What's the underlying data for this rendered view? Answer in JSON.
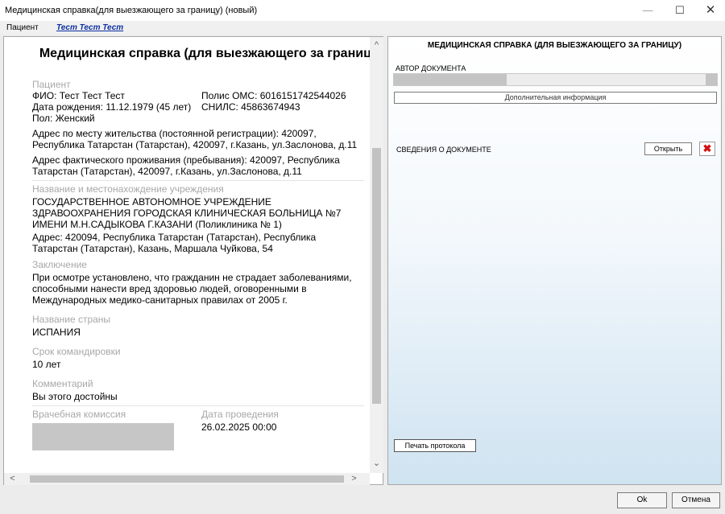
{
  "window": {
    "title": "Медицинская справка(для выезжающего за границу) (новый)",
    "minimize": "—",
    "maximize": "☐",
    "close": "✕"
  },
  "menubar": {
    "patient_label": "Пациент",
    "patient_name": "Тест Тест Тест"
  },
  "document": {
    "title": "Медицинская справка (для выезжающего за границу)",
    "patient_section": "Пациент",
    "fio": "ФИО: Тест Тест Тест",
    "oms": "Полис ОМС: 6016151742544026",
    "dob": "Дата рождения: 11.12.1979 (45 лет)",
    "snils": "СНИЛС: 45863674943",
    "sex": "Пол: Женский",
    "reg_address": "Адрес по месту жительства (постоянной регистрации): 420097, Республика Татарстан (Татарстан), 420097, г.Казань, ул.Заслонова, д.11",
    "fact_address": "Адрес фактического проживания (пребывания): 420097, Республика Татарстан (Татарстан), 420097, г.Казань, ул.Заслонова, д.11",
    "org_section": "Название и местонахождение учреждения",
    "org_name": "ГОСУДАРСТВЕННОЕ АВТОНОМНОЕ УЧРЕЖДЕНИЕ ЗДРАВООХРАНЕНИЯ ГОРОДСКАЯ КЛИНИЧЕСКАЯ БОЛЬНИЦА №7 ИМЕНИ М.Н.САДЫКОВА Г.КАЗАНИ (Поликлиника № 1)",
    "org_address": "Адрес: 420094, Республика Татарстан (Татарстан), Республика Татарстан (Татарстан), Казань, Маршала Чуйкова, 54",
    "conclusion_section": "Заключение",
    "conclusion": "При осмотре установлено, что гражданин не страдает заболеваниями, способными нанести вред здоровью людей, оговоренными в Международных медико-санитарных правилах от 2005 г.",
    "country_section": "Название страны",
    "country": "ИСПАНИЯ",
    "term_section": "Срок командировки",
    "term": "10 лет",
    "comment_section": "Комментарий",
    "comment": "Вы этого достойны",
    "commission_section": "Врачебная комиссия",
    "date_section": "Дата проведения",
    "date": "26.02.2025 00:00"
  },
  "scroll": {
    "up": "^",
    "down": "⌄",
    "left": "<",
    "right": ">"
  },
  "right_panel": {
    "title": "МЕДИЦИНСКАЯ СПРАВКА  (ДЛЯ ВЫЕЗЖАЮЩЕГО ЗА ГРАНИЦУ)",
    "author_label": "АВТОР ДОКУМЕНТА",
    "extra_info_button": "Дополнительная информация",
    "doc_info_label": "СВЕДЕНИЯ О ДОКУМЕНТЕ",
    "open_button": "Открыть",
    "delete_icon": "✖",
    "print_button": "Печать протокола"
  },
  "footer": {
    "ok": "Ok",
    "cancel": "Отмена"
  }
}
